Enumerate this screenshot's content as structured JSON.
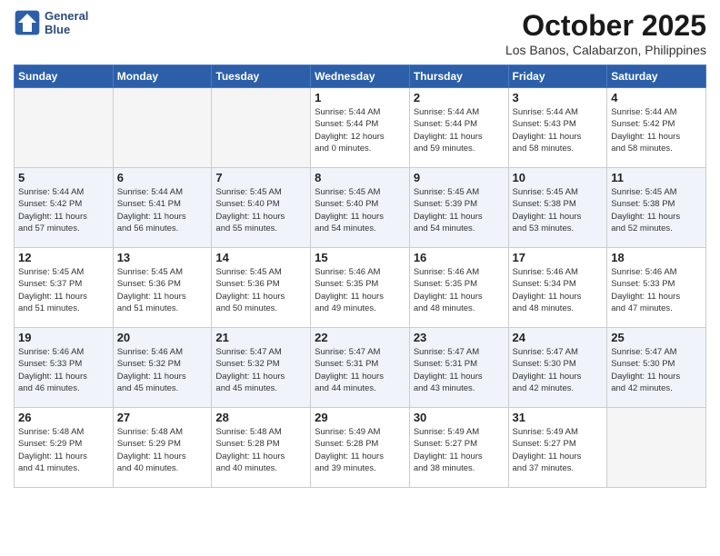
{
  "header": {
    "logo_line1": "General",
    "logo_line2": "Blue",
    "month_title": "October 2025",
    "location": "Los Banos, Calabarzon, Philippines"
  },
  "weekdays": [
    "Sunday",
    "Monday",
    "Tuesday",
    "Wednesday",
    "Thursday",
    "Friday",
    "Saturday"
  ],
  "weeks": [
    [
      {
        "day": "",
        "info": ""
      },
      {
        "day": "",
        "info": ""
      },
      {
        "day": "",
        "info": ""
      },
      {
        "day": "1",
        "info": "Sunrise: 5:44 AM\nSunset: 5:44 PM\nDaylight: 12 hours\nand 0 minutes."
      },
      {
        "day": "2",
        "info": "Sunrise: 5:44 AM\nSunset: 5:44 PM\nDaylight: 11 hours\nand 59 minutes."
      },
      {
        "day": "3",
        "info": "Sunrise: 5:44 AM\nSunset: 5:43 PM\nDaylight: 11 hours\nand 58 minutes."
      },
      {
        "day": "4",
        "info": "Sunrise: 5:44 AM\nSunset: 5:42 PM\nDaylight: 11 hours\nand 58 minutes."
      }
    ],
    [
      {
        "day": "5",
        "info": "Sunrise: 5:44 AM\nSunset: 5:42 PM\nDaylight: 11 hours\nand 57 minutes."
      },
      {
        "day": "6",
        "info": "Sunrise: 5:44 AM\nSunset: 5:41 PM\nDaylight: 11 hours\nand 56 minutes."
      },
      {
        "day": "7",
        "info": "Sunrise: 5:45 AM\nSunset: 5:40 PM\nDaylight: 11 hours\nand 55 minutes."
      },
      {
        "day": "8",
        "info": "Sunrise: 5:45 AM\nSunset: 5:40 PM\nDaylight: 11 hours\nand 54 minutes."
      },
      {
        "day": "9",
        "info": "Sunrise: 5:45 AM\nSunset: 5:39 PM\nDaylight: 11 hours\nand 54 minutes."
      },
      {
        "day": "10",
        "info": "Sunrise: 5:45 AM\nSunset: 5:38 PM\nDaylight: 11 hours\nand 53 minutes."
      },
      {
        "day": "11",
        "info": "Sunrise: 5:45 AM\nSunset: 5:38 PM\nDaylight: 11 hours\nand 52 minutes."
      }
    ],
    [
      {
        "day": "12",
        "info": "Sunrise: 5:45 AM\nSunset: 5:37 PM\nDaylight: 11 hours\nand 51 minutes."
      },
      {
        "day": "13",
        "info": "Sunrise: 5:45 AM\nSunset: 5:36 PM\nDaylight: 11 hours\nand 51 minutes."
      },
      {
        "day": "14",
        "info": "Sunrise: 5:45 AM\nSunset: 5:36 PM\nDaylight: 11 hours\nand 50 minutes."
      },
      {
        "day": "15",
        "info": "Sunrise: 5:46 AM\nSunset: 5:35 PM\nDaylight: 11 hours\nand 49 minutes."
      },
      {
        "day": "16",
        "info": "Sunrise: 5:46 AM\nSunset: 5:35 PM\nDaylight: 11 hours\nand 48 minutes."
      },
      {
        "day": "17",
        "info": "Sunrise: 5:46 AM\nSunset: 5:34 PM\nDaylight: 11 hours\nand 48 minutes."
      },
      {
        "day": "18",
        "info": "Sunrise: 5:46 AM\nSunset: 5:33 PM\nDaylight: 11 hours\nand 47 minutes."
      }
    ],
    [
      {
        "day": "19",
        "info": "Sunrise: 5:46 AM\nSunset: 5:33 PM\nDaylight: 11 hours\nand 46 minutes."
      },
      {
        "day": "20",
        "info": "Sunrise: 5:46 AM\nSunset: 5:32 PM\nDaylight: 11 hours\nand 45 minutes."
      },
      {
        "day": "21",
        "info": "Sunrise: 5:47 AM\nSunset: 5:32 PM\nDaylight: 11 hours\nand 45 minutes."
      },
      {
        "day": "22",
        "info": "Sunrise: 5:47 AM\nSunset: 5:31 PM\nDaylight: 11 hours\nand 44 minutes."
      },
      {
        "day": "23",
        "info": "Sunrise: 5:47 AM\nSunset: 5:31 PM\nDaylight: 11 hours\nand 43 minutes."
      },
      {
        "day": "24",
        "info": "Sunrise: 5:47 AM\nSunset: 5:30 PM\nDaylight: 11 hours\nand 42 minutes."
      },
      {
        "day": "25",
        "info": "Sunrise: 5:47 AM\nSunset: 5:30 PM\nDaylight: 11 hours\nand 42 minutes."
      }
    ],
    [
      {
        "day": "26",
        "info": "Sunrise: 5:48 AM\nSunset: 5:29 PM\nDaylight: 11 hours\nand 41 minutes."
      },
      {
        "day": "27",
        "info": "Sunrise: 5:48 AM\nSunset: 5:29 PM\nDaylight: 11 hours\nand 40 minutes."
      },
      {
        "day": "28",
        "info": "Sunrise: 5:48 AM\nSunset: 5:28 PM\nDaylight: 11 hours\nand 40 minutes."
      },
      {
        "day": "29",
        "info": "Sunrise: 5:49 AM\nSunset: 5:28 PM\nDaylight: 11 hours\nand 39 minutes."
      },
      {
        "day": "30",
        "info": "Sunrise: 5:49 AM\nSunset: 5:27 PM\nDaylight: 11 hours\nand 38 minutes."
      },
      {
        "day": "31",
        "info": "Sunrise: 5:49 AM\nSunset: 5:27 PM\nDaylight: 11 hours\nand 37 minutes."
      },
      {
        "day": "",
        "info": ""
      }
    ]
  ]
}
